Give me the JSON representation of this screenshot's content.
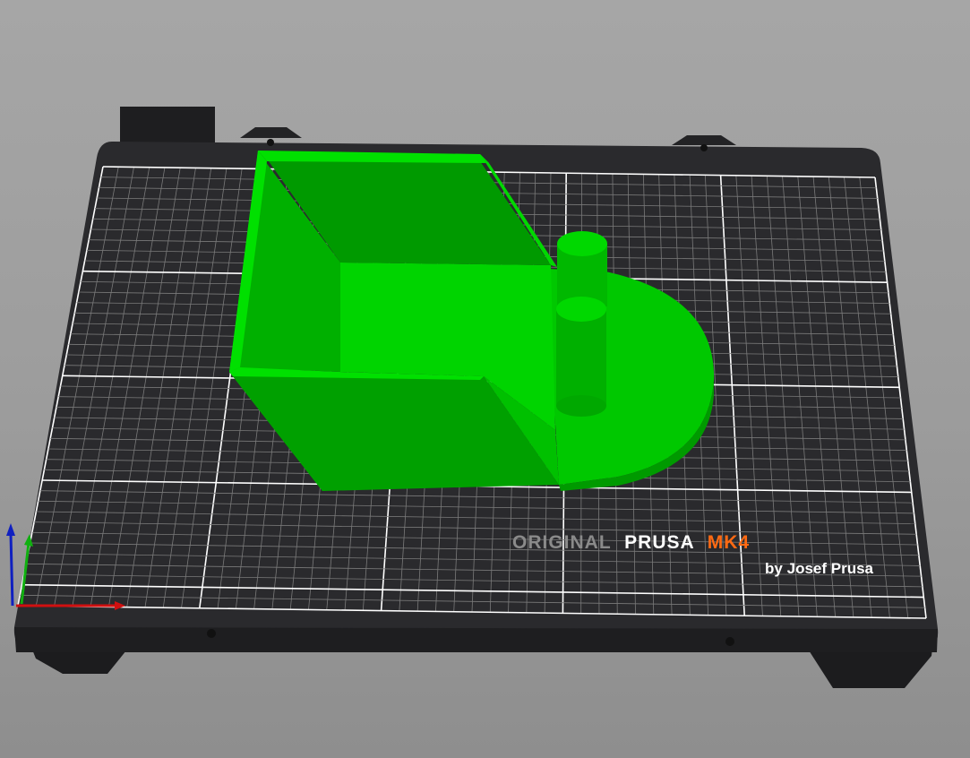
{
  "viewport": {
    "background": "#9e9e9e"
  },
  "bed": {
    "branding": {
      "prefix": "ORIGINAL",
      "brand": "PRUSA",
      "model": "MK4",
      "byline": "by Josef Prusa"
    },
    "colors": {
      "plate": "#2a2a2d",
      "frame": "#1f1f21",
      "grid_major": "#ffffff",
      "grid_minor": "#7a7a7a",
      "prefix_text": "#8a8a8a",
      "brand_text": "#ffffff",
      "model_text": "#ff6a13"
    }
  },
  "model": {
    "color": "#00c800",
    "color_dark": "#009d00",
    "color_light": "#00e000"
  },
  "axes": {
    "x_color": "#d01010",
    "y_color": "#10b010",
    "z_color": "#1020c0"
  }
}
